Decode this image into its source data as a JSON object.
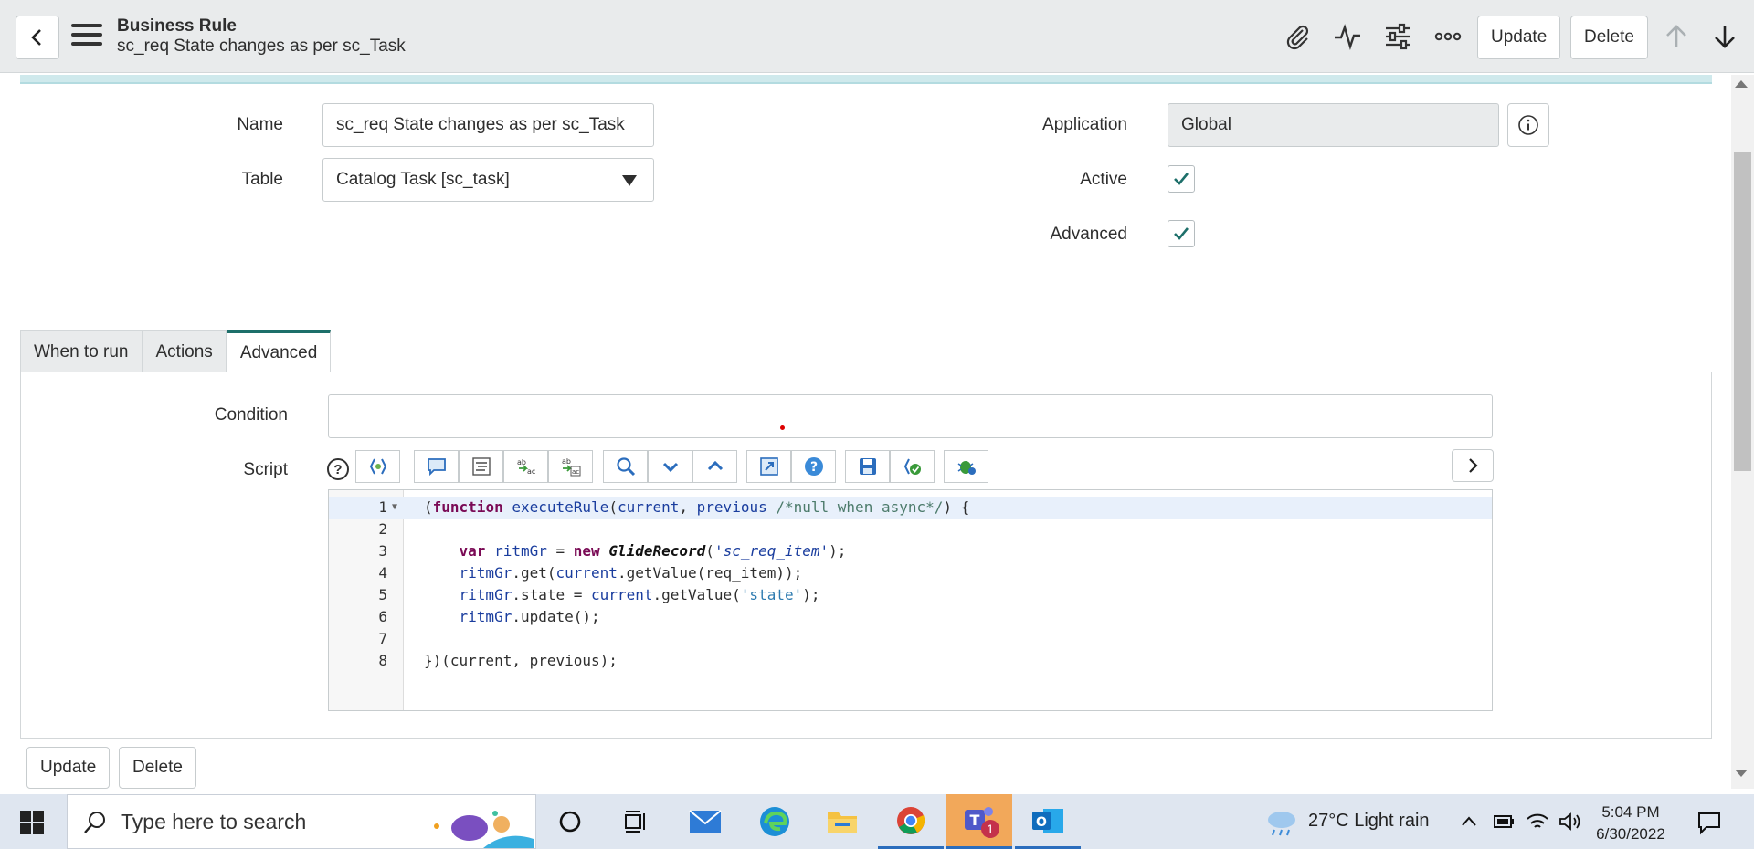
{
  "header": {
    "title": "Business Rule",
    "subtitle": "sc_req State changes as per sc_Task",
    "update_label": "Update",
    "delete_label": "Delete"
  },
  "form": {
    "name_label": "Name",
    "name_value": "sc_req State changes as per sc_Task",
    "table_label": "Table",
    "table_value": "Catalog Task [sc_task]",
    "application_label": "Application",
    "application_value": "Global",
    "active_label": "Active",
    "active_checked": true,
    "advanced_label": "Advanced",
    "advanced_checked": true
  },
  "tabs": [
    {
      "label": "When to run",
      "active": false
    },
    {
      "label": "Actions",
      "active": false
    },
    {
      "label": "Advanced",
      "active": true
    }
  ],
  "advanced": {
    "condition_label": "Condition",
    "condition_value": "",
    "script_label": "Script",
    "help_symbol": "?"
  },
  "script_lines": [
    {
      "n": "1",
      "text": "(function executeRule(current, previous /*null when async*/) {"
    },
    {
      "n": "2",
      "text": ""
    },
    {
      "n": "3",
      "text": "    var ritmGr = new GlideRecord('sc_req_item');"
    },
    {
      "n": "4",
      "text": "    ritmGr.get(current.getValue(req_item));"
    },
    {
      "n": "5",
      "text": "    ritmGr.state = current.getValue('state');"
    },
    {
      "n": "6",
      "text": "    ritmGr.update();"
    },
    {
      "n": "7",
      "text": ""
    },
    {
      "n": "8",
      "text": "})(current, previous);"
    }
  ],
  "footer": {
    "update_label": "Update",
    "delete_label": "Delete"
  },
  "taskbar": {
    "search_placeholder": "Type here to search",
    "weather": "27°C  Light rain",
    "time": "5:04 PM",
    "date": "6/30/2022",
    "teams_badge": "1"
  },
  "icons": {
    "header": [
      "back-icon",
      "menu-icon",
      "paperclip-icon",
      "activity-icon",
      "settings-sliders-icon",
      "more-icon",
      "arrow-up-icon",
      "arrow-down-icon"
    ],
    "script_toolbar": [
      "toggle-syntax-icon",
      "comment-icon",
      "format-icon",
      "replace-icon",
      "replace-all-icon",
      "search-icon",
      "find-next-icon",
      "find-previous-icon",
      "fullscreen-icon",
      "help-icon",
      "save-icon",
      "validate-icon",
      "debug-icon"
    ]
  },
  "colors": {
    "accent_teal": "#1d6f6a",
    "header_bg": "#e9ebec",
    "checkbox_check": "#1d6f6a"
  }
}
